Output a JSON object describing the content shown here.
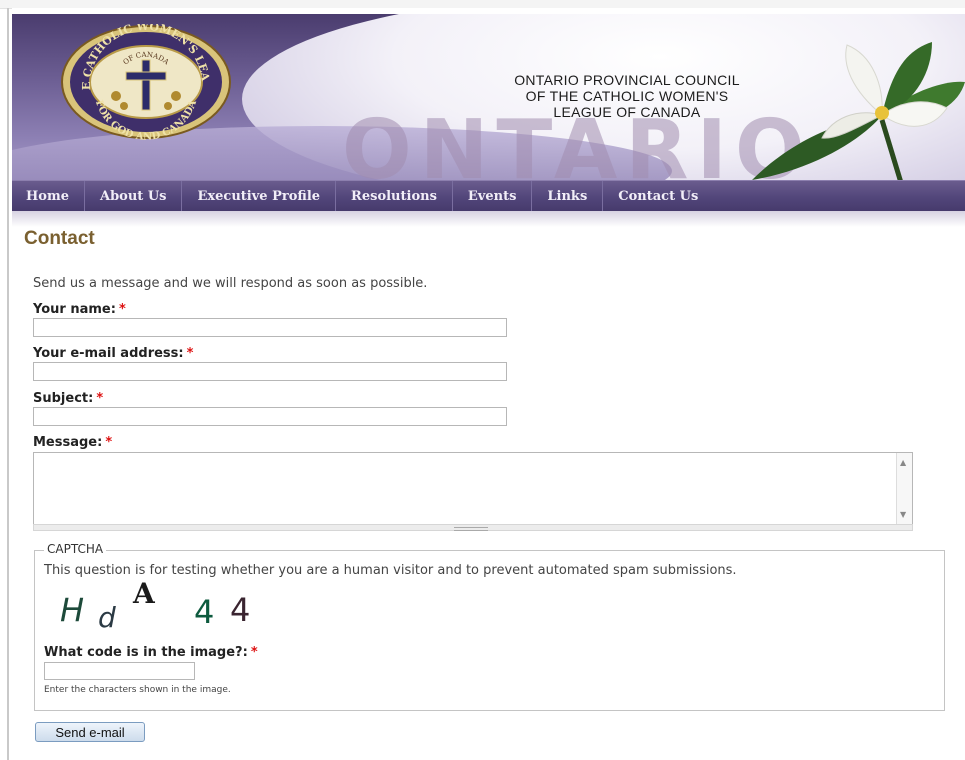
{
  "site": {
    "council_line1": "ONTARIO PROVINCIAL COUNCIL",
    "council_line2": "OF THE CATHOLIC WOMEN'S",
    "council_line3": "LEAGUE OF CANADA",
    "banner_word": "ONTARIO",
    "seal_text_top": "THE CATHOLIC WOMEN'S LEAGUE",
    "seal_text_inner": "OF CANADA",
    "seal_text_bottom": "FOR GOD AND CANADA"
  },
  "nav": {
    "items": [
      {
        "label": "Home"
      },
      {
        "label": "About Us"
      },
      {
        "label": "Executive Profile"
      },
      {
        "label": "Resolutions"
      },
      {
        "label": "Events"
      },
      {
        "label": "Links"
      },
      {
        "label": "Contact Us"
      }
    ]
  },
  "page": {
    "title": "Contact",
    "intro": "Send us a message and we will respond as soon as possible."
  },
  "form": {
    "required_mark": "*",
    "name_label": "Your name:",
    "name_value": "",
    "email_label": "Your e-mail address:",
    "email_value": "",
    "subject_label": "Subject:",
    "subject_value": "",
    "message_label": "Message:",
    "message_value": "",
    "submit_label": "Send e-mail"
  },
  "captcha": {
    "legend": "CAPTCHA",
    "description": "This question is for testing whether you are a human visitor and to prevent automated spam submissions.",
    "chars": [
      "H",
      "d",
      "A",
      "4",
      "4"
    ],
    "question_label": "What code is in the image?:",
    "answer_value": "",
    "hint": "Enter the characters shown in the image."
  },
  "colors": {
    "nav_bg": "#52467a",
    "title": "#7a6030",
    "required": "#dd1111"
  },
  "icons": {
    "seal": "cwl-seal-icon",
    "flower": "trillium-flower-icon",
    "scroll_up": "scroll-up-icon",
    "scroll_down": "scroll-down-icon"
  }
}
